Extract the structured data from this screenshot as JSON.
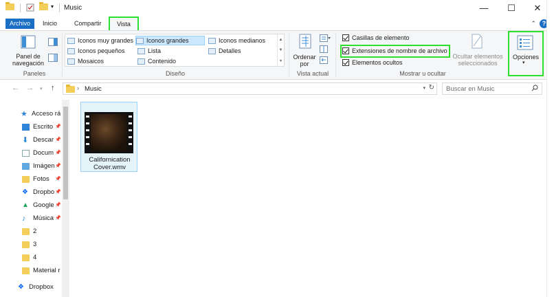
{
  "window": {
    "title": "Music",
    "controls": [
      "—",
      "☐",
      "✕"
    ]
  },
  "tabs": [
    "Archivo",
    "Inicio",
    "Compartir",
    "Vista"
  ],
  "help": "?",
  "panes": {
    "nav_pane_label": "Panel de navegación",
    "group_label": "Paneles"
  },
  "layout": {
    "items": [
      "Iconos muy grandes",
      "Iconos grandes",
      "Iconos medianos",
      "Iconos pequeños",
      "Lista",
      "Detalles",
      "Mosaicos",
      "Contenido"
    ],
    "selected": "Iconos grandes",
    "group_label": "Diseño"
  },
  "current_view": {
    "sort_label": "Ordenar por",
    "group_label": "Vista actual"
  },
  "show_hide": {
    "checkboxes": [
      {
        "label": "Casillas de elemento",
        "checked": true
      },
      {
        "label": "Extensiones de nombre de archivo",
        "checked": true
      },
      {
        "label": "Elementos ocultos",
        "checked": true
      }
    ],
    "hide_selected_label": "Ocultar elementos seleccionados",
    "group_label": "Mostrar u ocultar"
  },
  "options": {
    "label": "Opciones"
  },
  "address": {
    "path": "Music",
    "search_placeholder": "Buscar en Music"
  },
  "nav_items": [
    {
      "label": "Acceso rápi",
      "icon": "star-icon"
    },
    {
      "label": "Escrito",
      "icon": "desktop-icon"
    },
    {
      "label": "Descar",
      "icon": "download-icon"
    },
    {
      "label": "Docum",
      "icon": "document-icon"
    },
    {
      "label": "Imágen",
      "icon": "pictures-icon"
    },
    {
      "label": "Fotos",
      "icon": "folder-icon"
    },
    {
      "label": "Dropbo",
      "icon": "dropbox-icon"
    },
    {
      "label": "Google",
      "icon": "google-drive-icon"
    },
    {
      "label": "Música",
      "icon": "music-icon"
    },
    {
      "label": "2",
      "icon": "folder-icon"
    },
    {
      "label": "3",
      "icon": "folder-icon"
    },
    {
      "label": "4",
      "icon": "folder-icon"
    },
    {
      "label": "Material r",
      "icon": "folder-icon"
    },
    {
      "label": "Dropbox",
      "icon": "dropbox-icon"
    }
  ],
  "files": [
    {
      "name": "Californication Cover.wmv"
    }
  ],
  "colors": {
    "accent": "#1a6fc4",
    "highlight": "#2ee02e",
    "selection": "#cce8ff"
  }
}
